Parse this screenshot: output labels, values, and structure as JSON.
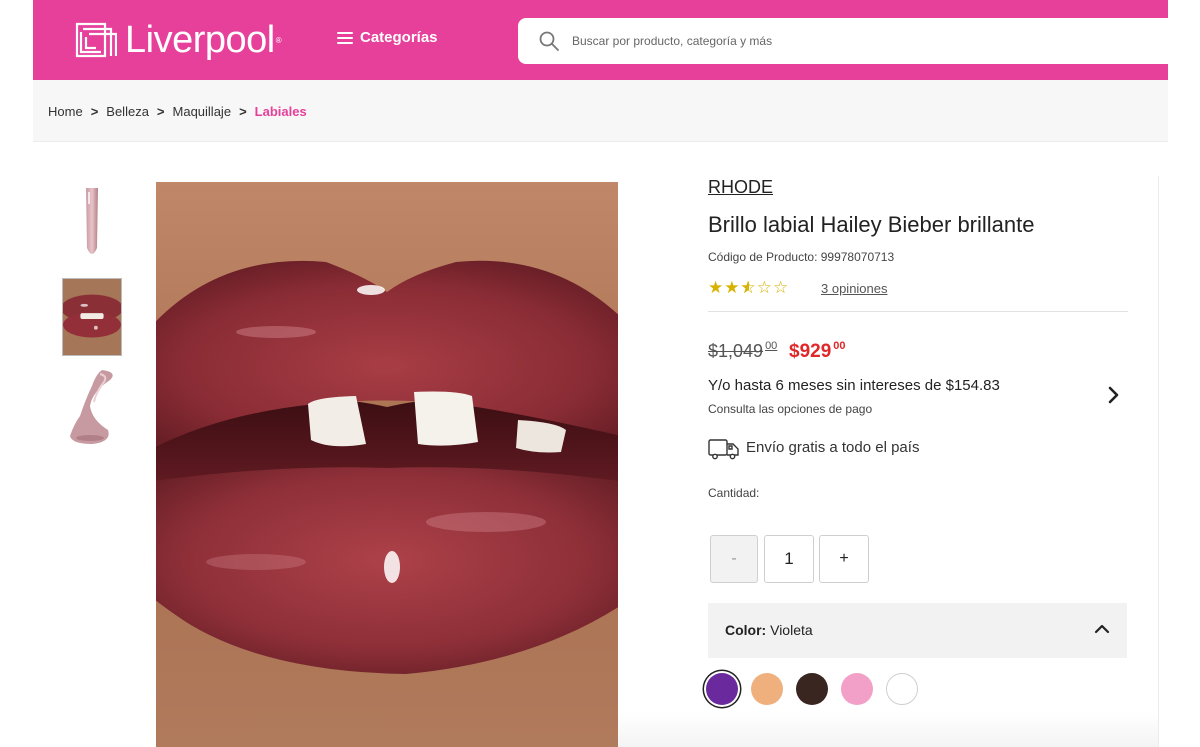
{
  "header": {
    "logo_text": "Liverpool",
    "logo_reg": "®",
    "categories_label": "Categorías",
    "search_placeholder": "Buscar por producto, categoría y más",
    "brand_color": "#e6409b"
  },
  "breadcrumb": {
    "items": [
      "Home",
      "Belleza",
      "Maquillaje"
    ],
    "current": "Labiales",
    "separator": ">"
  },
  "gallery": {
    "thumbnails": [
      "lip-gloss-tube",
      "glossy-lips-closeup",
      "gloss-swirl"
    ],
    "selected_index": 1,
    "main_image": "glossy-lips-closeup"
  },
  "product": {
    "brand": "RHODE",
    "title": "Brillo labial Hailey Bieber brillante",
    "code": "Código de Producto: 99978070713",
    "rating": 2.5,
    "rating_max": 5,
    "reviews": "3 opiniones",
    "old_price": "$1,049",
    "old_price_cents": "00",
    "new_price": "$929",
    "new_price_cents": "00",
    "installments": "Y/o hasta 6 meses sin intereses de $154.83",
    "installments_sub": "Consulta las opciones de pago",
    "shipping": "Envío gratis a todo el país",
    "quantity_label": "Cantidad:",
    "quantity_minus": "-",
    "quantity": "1",
    "quantity_plus": "+",
    "color_label": "Color:",
    "color_value": "Violeta",
    "swatches": [
      {
        "name": "Violeta",
        "color": "#6a2a9e",
        "selected": true
      },
      {
        "name": "Durazno",
        "color": "#f0b07e",
        "selected": false
      },
      {
        "name": "Café",
        "color": "#3a2620",
        "selected": false
      },
      {
        "name": "Rosa",
        "color": "#f2a0c7",
        "selected": false
      },
      {
        "name": "Blanco",
        "color": "#ffffff",
        "selected": false
      }
    ]
  }
}
